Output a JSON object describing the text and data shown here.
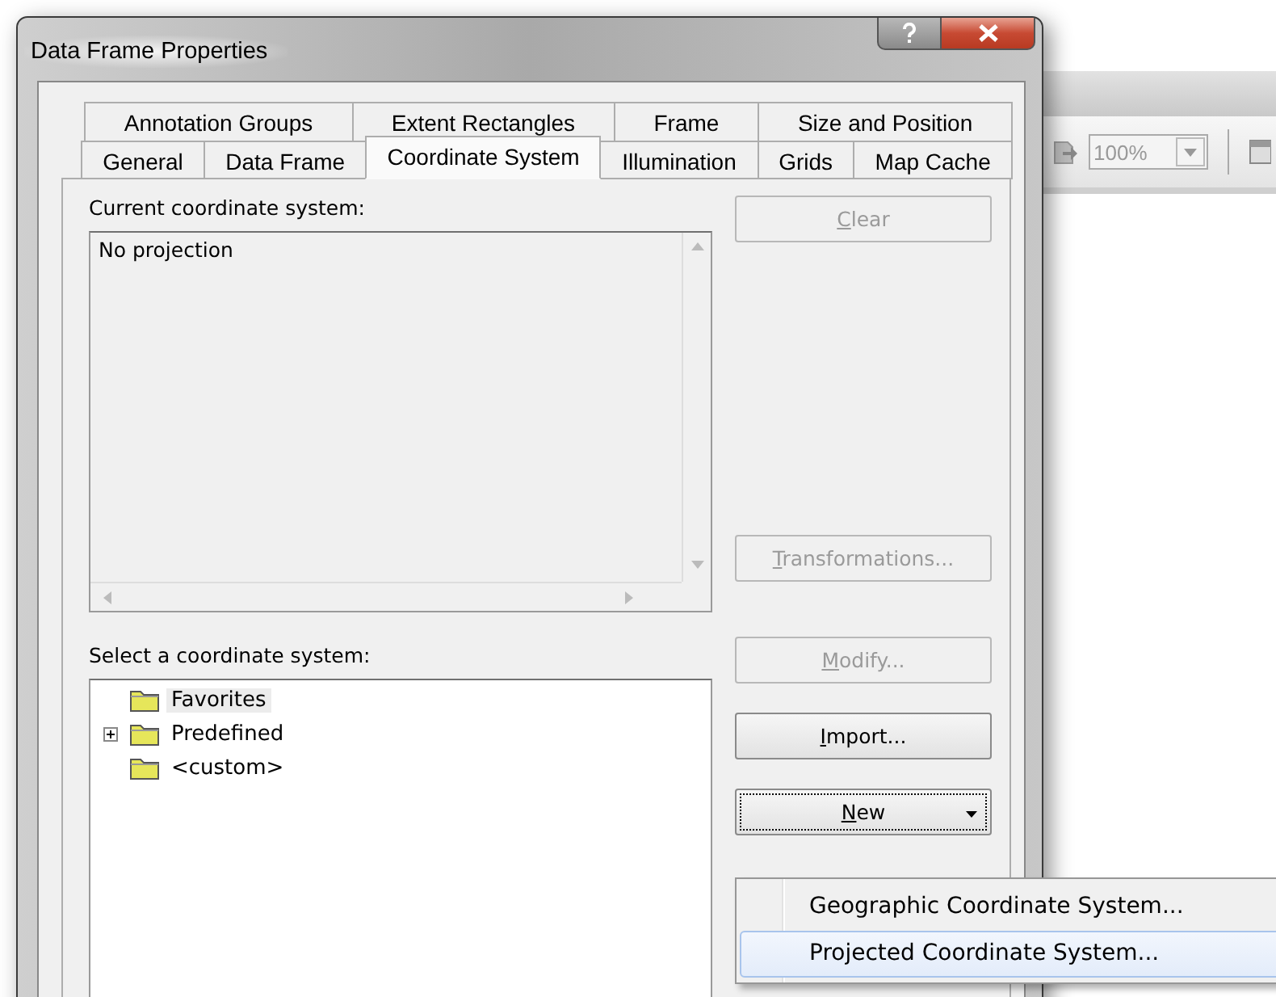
{
  "background_window": {
    "zoom_combo": {
      "value": "100%"
    }
  },
  "dialog": {
    "title": "Data Frame Properties",
    "tab_rows": [
      [
        {
          "label": "Annotation Groups",
          "selected": false
        },
        {
          "label": "Extent Rectangles",
          "selected": false
        },
        {
          "label": "Frame",
          "selected": false
        },
        {
          "label": "Size and Position",
          "selected": false
        }
      ],
      [
        {
          "label": "General",
          "selected": false
        },
        {
          "label": "Data Frame",
          "selected": false
        },
        {
          "label": "Coordinate System",
          "selected": true
        },
        {
          "label": "Illumination",
          "selected": false
        },
        {
          "label": "Grids",
          "selected": false
        },
        {
          "label": "Map Cache",
          "selected": false
        }
      ]
    ],
    "current_label": "Current coordinate system:",
    "current_value": "No projection",
    "select_label": "Select a coordinate system:",
    "tree": [
      {
        "label": "Favorites",
        "selected": true,
        "collapsed": false
      },
      {
        "label": "Predefined",
        "selected": false,
        "collapsed": true
      },
      {
        "label": "<custom>",
        "selected": false,
        "collapsed": false
      }
    ],
    "buttons": {
      "clear": {
        "label": "Clear",
        "disabled": true,
        "focused": false
      },
      "transformations": {
        "label": "Transformations...",
        "disabled": true,
        "focused": false
      },
      "modify": {
        "label": "Modify...",
        "disabled": true,
        "focused": false
      },
      "import": {
        "label": "Import...",
        "disabled": false,
        "focused": false
      },
      "new": {
        "label": "New",
        "disabled": false,
        "focused": true
      }
    },
    "new_menu": [
      {
        "label": "Geographic Coordinate System...",
        "selected": false
      },
      {
        "label": "Projected Coordinate System...",
        "selected": true
      }
    ]
  }
}
